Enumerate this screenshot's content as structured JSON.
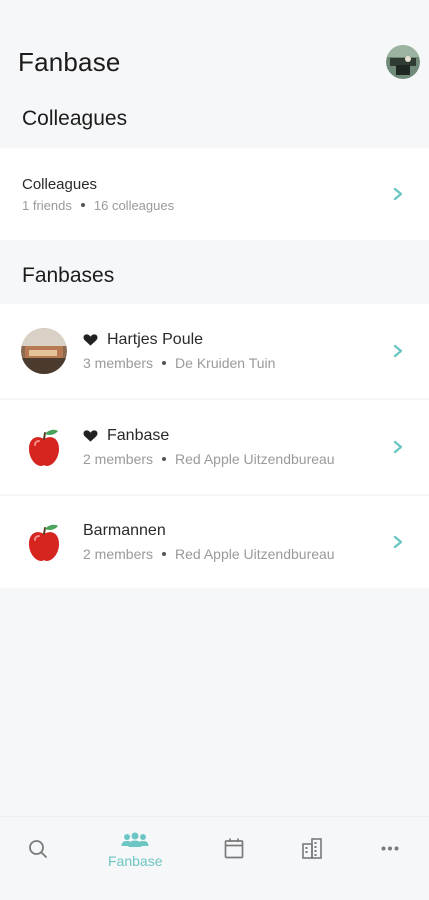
{
  "header": {
    "title": "Fanbase"
  },
  "colleagues_section": {
    "title": "Colleagues",
    "row": {
      "title": "Colleagues",
      "friends": "1 friends",
      "colleagues": "16 colleagues"
    }
  },
  "fanbases_section": {
    "title": "Fanbases",
    "items": [
      {
        "name": "Hartjes Poule",
        "members": "3 members",
        "org": "De Kruiden Tuin",
        "favorite": true,
        "avatar": "photo-avatar"
      },
      {
        "name": "Fanbase",
        "members": "2 members",
        "org": "Red Apple Uitzendbureau",
        "favorite": true,
        "avatar": "apple-icon"
      },
      {
        "name": "Barmannen",
        "members": "2 members",
        "org": "Red Apple Uitzendbureau",
        "favorite": false,
        "avatar": "apple-icon"
      }
    ]
  },
  "bottom_nav": {
    "items": [
      {
        "icon": "search-icon",
        "label": ""
      },
      {
        "icon": "people-icon",
        "label": "Fanbase",
        "active": true
      },
      {
        "icon": "calendar-icon",
        "label": ""
      },
      {
        "icon": "building-icon",
        "label": ""
      },
      {
        "icon": "more-icon",
        "label": ""
      }
    ]
  },
  "colors": {
    "accent": "#6cc6c3",
    "background": "#f6f7f9",
    "card": "#ffffff",
    "apple_red": "#d6241f",
    "leaf_green": "#4aa35a"
  }
}
